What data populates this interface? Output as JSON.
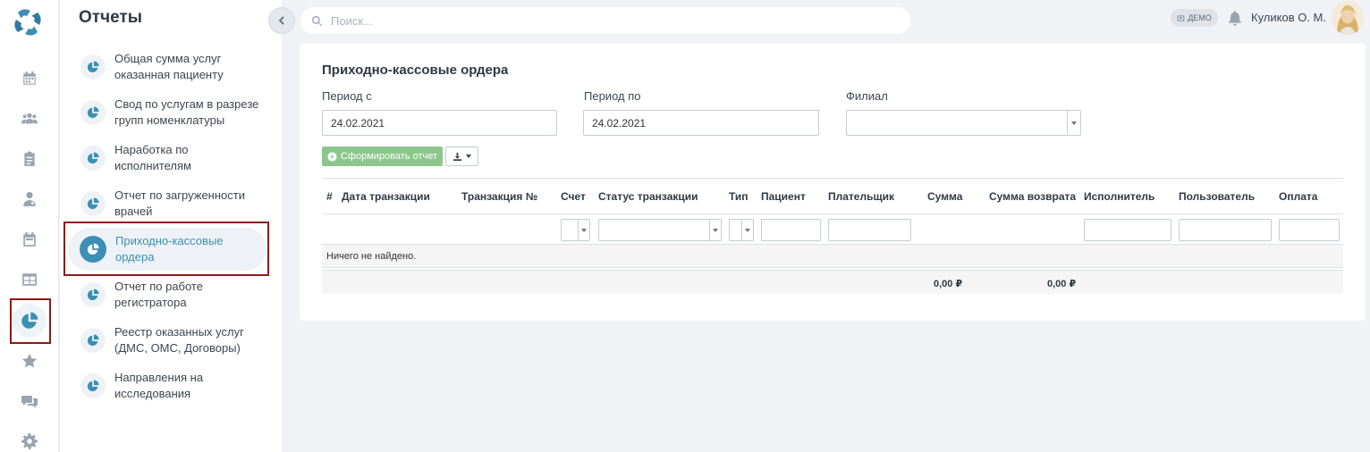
{
  "rail": {
    "items": [
      {
        "name": "calendar-icon"
      },
      {
        "name": "patients-icon"
      },
      {
        "name": "clipboard-icon"
      },
      {
        "name": "doctor-icon"
      },
      {
        "name": "schedule-icon"
      },
      {
        "name": "table-icon"
      },
      {
        "name": "reports-pie-icon",
        "active": true
      },
      {
        "name": "star-icon"
      },
      {
        "name": "chat-icon"
      },
      {
        "name": "settings-gear-icon"
      }
    ]
  },
  "subnav": {
    "title": "Отчеты",
    "items": [
      {
        "line1": "Общая сумма услуг",
        "line2": "оказанная пациенту"
      },
      {
        "line1": "Свод по услугам в разрезе",
        "line2": "групп номенклатуры"
      },
      {
        "line1": "Наработка по",
        "line2": "исполнителям"
      },
      {
        "line1": "Отчет по загруженности",
        "line2": "врачей"
      },
      {
        "line1": "Приходно-кассовые",
        "line2": "ордера",
        "active": true
      },
      {
        "line1": "Отчет по работе",
        "line2": "регистратора"
      },
      {
        "line1": "Реестр оказанных услуг",
        "line2": "(ДМС, ОМС, Договоры)"
      },
      {
        "line1": "Направления на",
        "line2": "исследования"
      }
    ]
  },
  "topbar": {
    "search_placeholder": "Поиск...",
    "demo_badge": "ДЕМО",
    "user_name": "Куликов О. М."
  },
  "report": {
    "title": "Приходно-кассовые ордера",
    "period_from_label": "Период с",
    "period_from_value": "24.02.2021",
    "period_to_label": "Период по",
    "period_to_value": "24.02.2021",
    "branch_label": "Филиал",
    "branch_value": "",
    "generate_button": "Сформировать отчет"
  },
  "table": {
    "columns": [
      "#",
      "Дата транзакции",
      "Транзакция №",
      "Счет",
      "Статус транзакции",
      "Тип",
      "Пациент",
      "Плательщик",
      "Сумма",
      "Сумма возврата",
      "Исполнитель",
      "Пользователь",
      "Оплата"
    ],
    "empty_message": "Ничего не найдено.",
    "total_sum": "0,00 ₽",
    "total_refund": "0,00 ₽"
  },
  "colors": {
    "accent": "#3b8fb5",
    "generate_button": "#8bc78b",
    "highlight_frame": "#8b1a1a"
  }
}
